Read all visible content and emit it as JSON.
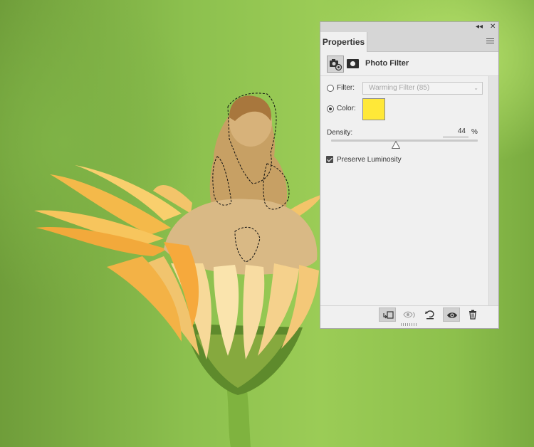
{
  "panel": {
    "tab_label": "Properties",
    "collapse_glyph": "◂◂",
    "close_glyph": "✕",
    "menu_icon": "hamburger-menu-icon",
    "header_title": "Photo Filter",
    "icons": {
      "adjustment": "camera-adjustment-icon",
      "mask": "layer-mask-icon"
    }
  },
  "filter": {
    "label": "Filter:",
    "value": "Warming Filter (85)",
    "selected": false
  },
  "color": {
    "label": "Color:",
    "swatch": "#ffe838",
    "selected": true
  },
  "density": {
    "label": "Density:",
    "value": "44",
    "unit": "%",
    "fraction": 0.44
  },
  "preserve_luminosity": {
    "label": "Preserve Luminosity",
    "checked": true
  },
  "footer_buttons": [
    "clip-to-layer-icon",
    "view-previous-state-icon",
    "reset-icon",
    "visibility-eye-icon",
    "trash-icon"
  ]
}
